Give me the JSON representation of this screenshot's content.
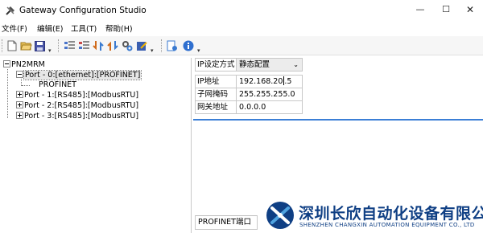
{
  "window": {
    "title": "Gateway Configuration Studio",
    "icon": "tools-icon",
    "controls": {
      "minimize": "—",
      "maximize": "☐",
      "close": "✕"
    }
  },
  "menu": {
    "items": [
      {
        "label": "文件(F)"
      },
      {
        "label": "编辑(E)"
      },
      {
        "label": "工具(T)"
      },
      {
        "label": "帮助(H)"
      }
    ]
  },
  "toolbar": {
    "dropdown_glyph": "▾",
    "buttons": [
      "new-file-icon",
      "open-folder-icon",
      "save-icon",
      "add-config-icon",
      "remove-config-icon",
      "download-icon",
      "upload-icon",
      "settings-icon",
      "write-icon",
      "config-doc-icon",
      "info-icon"
    ]
  },
  "tree": {
    "root": "PN2MRM",
    "ports": [
      {
        "label": "Port - 0:[ethernet]:[PROFINET]",
        "selected": true,
        "child": "PROFINET"
      },
      {
        "label": "Port - 1:[RS485]:[ModbusRTU]"
      },
      {
        "label": "Port - 2:[RS485]:[ModbusRTU]"
      },
      {
        "label": "Port - 3:[RS485]:[ModbusRTU]"
      }
    ]
  },
  "properties": {
    "ip_mode": {
      "label": "IP设定方式",
      "value": "静态配置"
    },
    "ip": {
      "label": "IP地址",
      "value_before_cursor": "192.168.20",
      "value_after_cursor": ".5"
    },
    "mask": {
      "label": "子网掩码",
      "value": "255.255.255.0"
    },
    "gateway": {
      "label": "网关地址",
      "value": "0.0.0.0"
    }
  },
  "bottom_tab": {
    "label": "PROFINET端口"
  },
  "watermark": {
    "company_cn": "深圳长欣自动化设备有限公司",
    "company_en": "SHENZHEN CHANGXIN AUTOMATION EQUIPMENT CO., LTD"
  },
  "colors": {
    "accent_line": "#3b7fd6",
    "watermark_blue": "#0f3f84"
  }
}
